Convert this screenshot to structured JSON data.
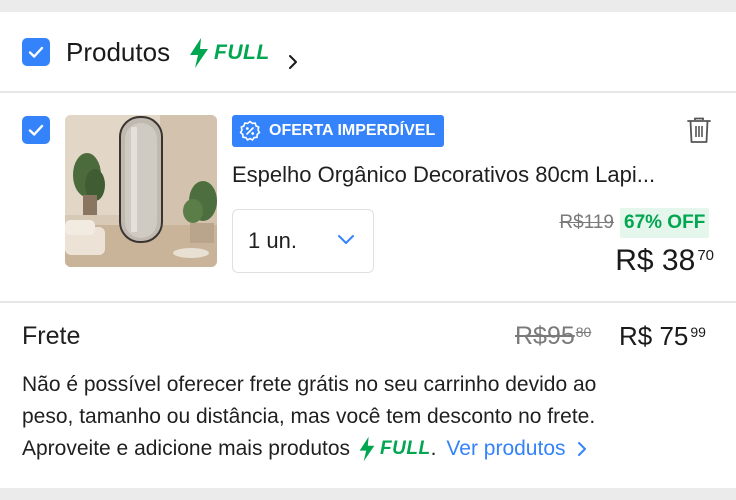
{
  "colors": {
    "accent": "#3483fa",
    "full_green": "#00a650",
    "discount_bg": "#e5f6ec",
    "page_bg": "#ebebeb"
  },
  "header": {
    "title": "Produtos",
    "full_label": "FULL",
    "checked": true
  },
  "item": {
    "checked": true,
    "badge": "OFERTA IMPERDÍVEL",
    "title": "Espelho Orgânico Decorativos 80cm Lapi...",
    "quantity": "1 un.",
    "old_price": "R$119",
    "discount": "67% OFF",
    "price_main": "R$ 38",
    "price_cents": "70"
  },
  "shipping": {
    "label": "Frete",
    "old_price_main": "R$95",
    "old_price_cents": "80",
    "price_main": "R$ 75",
    "price_cents": "99",
    "info_line1": "Não é possível oferecer frete grátis no seu carrinho devido ao",
    "info_line2": "peso, tamanho ou distância, mas você tem desconto no frete.",
    "info_line3_prefix": "Aproveite e adicione mais produtos",
    "full_label": "FULL",
    "info_line3_suffix": ".",
    "link_label": "Ver produtos"
  }
}
